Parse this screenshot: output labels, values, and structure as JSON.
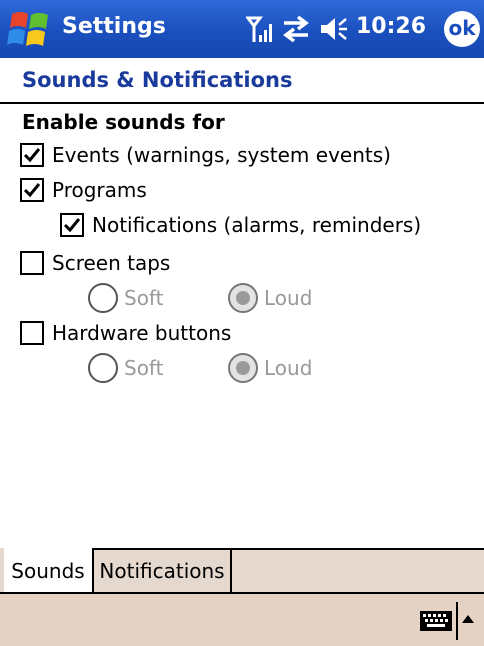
{
  "titlebar": {
    "app_title": "Settings",
    "clock": "10:26",
    "ok_label": "ok",
    "icons": [
      "windows-start-icon",
      "signal-icon",
      "sync-icon",
      "volume-icon"
    ]
  },
  "page": {
    "title": "Sounds & Notifications",
    "section_label": "Enable sounds for"
  },
  "options": {
    "events": {
      "label": "Events (warnings, system events)",
      "checked": true
    },
    "programs": {
      "label": "Programs",
      "checked": true
    },
    "notifications": {
      "label": "Notifications (alarms, reminders)",
      "checked": true
    },
    "screen_taps": {
      "label": "Screen taps",
      "checked": false,
      "soft_label": "Soft",
      "loud_label": "Loud",
      "selected": "Loud"
    },
    "hardware_buttons": {
      "label": "Hardware buttons",
      "checked": false,
      "soft_label": "Soft",
      "loud_label": "Loud",
      "selected": "Loud"
    }
  },
  "tabs": [
    {
      "label": "Sounds",
      "active": true
    },
    {
      "label": "Notifications",
      "active": false
    }
  ],
  "colors": {
    "titlebar_blue": "#1a4fbe",
    "heading_blue": "#1a3a9c",
    "menubar_bg": "#e4d2c5",
    "disabled_text": "#9a9a9a"
  }
}
